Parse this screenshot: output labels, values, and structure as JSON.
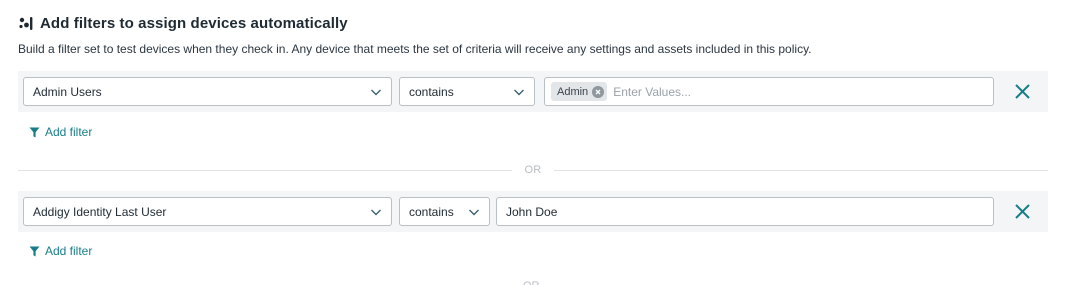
{
  "header": {
    "icon": "nodes-icon",
    "title": "Add filters to assign devices automatically",
    "subtitle": "Build a filter set to test devices when they check in. Any device that meets the set of criteria will receive any settings and assets included in this policy."
  },
  "filter_groups": [
    {
      "field": "Admin Users",
      "operator": "contains",
      "tags": [
        "Admin"
      ],
      "value_placeholder": "Enter Values...",
      "add_filter_label": "Add filter"
    },
    {
      "field": "Addigy Identity Last User",
      "operator": "contains",
      "value": "John Doe",
      "add_filter_label": "Add filter"
    }
  ],
  "separator_label": "OR",
  "colors": {
    "accent": "#177e89",
    "row_background": "#f4f5f6",
    "border": "#b9c0c6"
  }
}
